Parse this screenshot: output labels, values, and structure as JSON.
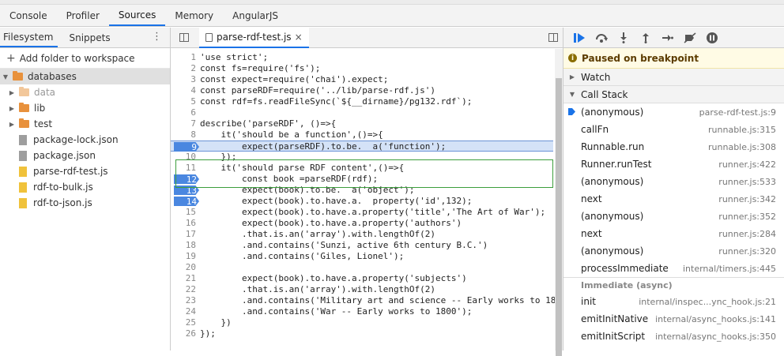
{
  "devtools_tabs": [
    "Console",
    "Profiler",
    "Sources",
    "Memory",
    "AngularJS"
  ],
  "active_tab": "Sources",
  "navigator": {
    "tabs": [
      "Filesystem",
      "Snippets"
    ],
    "add_folder": "Add folder to workspace",
    "tree": [
      {
        "label": "databases",
        "kind": "folder",
        "open": true,
        "depth": 0,
        "selected": true
      },
      {
        "label": "data",
        "kind": "folder",
        "open": false,
        "depth": 1,
        "dim": true
      },
      {
        "label": "lib",
        "kind": "folder",
        "open": false,
        "depth": 1
      },
      {
        "label": "test",
        "kind": "folder",
        "open": false,
        "depth": 1
      },
      {
        "label": "package-lock.json",
        "kind": "file-json",
        "depth": 1
      },
      {
        "label": "package.json",
        "kind": "file-json",
        "depth": 1
      },
      {
        "label": "parse-rdf-test.js",
        "kind": "file-js",
        "depth": 1
      },
      {
        "label": "rdf-to-bulk.js",
        "kind": "file-js",
        "depth": 1
      },
      {
        "label": "rdf-to-json.js",
        "kind": "file-js",
        "depth": 1
      }
    ]
  },
  "editor": {
    "filename": "parse-rdf-test.js",
    "close": "×",
    "lines": [
      {
        "n": "1",
        "text": "'use strict';"
      },
      {
        "n": "2",
        "text": "const fs=require('fs');"
      },
      {
        "n": "3",
        "text": "const expect=require('chai').expect;"
      },
      {
        "n": "4",
        "text": "const parseRDF=require('../lib/parse-rdf.js')"
      },
      {
        "n": "5",
        "text": "const rdf=fs.readFileSync(`${__dirname}/pg132.rdf`);"
      },
      {
        "n": "6",
        "text": ""
      },
      {
        "n": "7",
        "text": "describe('parseRDF', ()=>{"
      },
      {
        "n": "8",
        "text": "    it('should be a function',()=>{"
      },
      {
        "n": "9",
        "text": "        expect(parseRDF).to.be.  a('function');",
        "bp": true,
        "exec": true
      },
      {
        "n": "10",
        "text": "    });"
      },
      {
        "n": "11",
        "text": "    it('should parse RDF content',()=>{"
      },
      {
        "n": "12",
        "text": "        const book =parseRDF(rdf);",
        "bp": true
      },
      {
        "n": "13",
        "text": "        expect(book).to.be.  a('object');",
        "bp": true
      },
      {
        "n": "14",
        "text": "        expect(book).to.have.a.  property('id',132);",
        "bp": true
      },
      {
        "n": "15",
        "text": "        expect(book).to.have.a.property('title','The Art of War');"
      },
      {
        "n": "16",
        "text": "        expect(book).to.have.a.property('authors')"
      },
      {
        "n": "17",
        "text": "        .that.is.an('array').with.lengthOf(2)"
      },
      {
        "n": "18",
        "text": "        .and.contains('Sunzi, active 6th century B.C.')"
      },
      {
        "n": "19",
        "text": "        .and.contains('Giles, Lionel');"
      },
      {
        "n": "20",
        "text": ""
      },
      {
        "n": "21",
        "text": "        expect(book).to.have.a.property('subjects')"
      },
      {
        "n": "22",
        "text": "        .that.is.an('array').with.lengthOf(2)"
      },
      {
        "n": "23",
        "text": "        .and.contains('Military art and science -- Early works to 18"
      },
      {
        "n": "24",
        "text": "        .and.contains('War -- Early works to 1800');"
      },
      {
        "n": "25",
        "text": "    })"
      },
      {
        "n": "26",
        "text": "});"
      }
    ]
  },
  "debugger": {
    "paused": "Paused on breakpoint",
    "watch": "Watch",
    "call_stack": "Call Stack",
    "frames": [
      {
        "fn": "(anonymous)",
        "loc": "parse-rdf-test.js:9",
        "current": true
      },
      {
        "fn": "callFn",
        "loc": "runnable.js:315"
      },
      {
        "fn": "Runnable.run",
        "loc": "runnable.js:308"
      },
      {
        "fn": "Runner.runTest",
        "loc": "runner.js:422"
      },
      {
        "fn": "(anonymous)",
        "loc": "runner.js:533"
      },
      {
        "fn": "next",
        "loc": "runner.js:342"
      },
      {
        "fn": "(anonymous)",
        "loc": "runner.js:352"
      },
      {
        "fn": "next",
        "loc": "runner.js:284"
      },
      {
        "fn": "(anonymous)",
        "loc": "runner.js:320"
      },
      {
        "fn": "processImmediate",
        "loc": "internal/timers.js:445"
      }
    ],
    "async_label": "Immediate (async)",
    "async_frames": [
      {
        "fn": "init",
        "loc": "internal/inspec...ync_hook.js:21"
      },
      {
        "fn": "emitInitNative",
        "loc": "internal/async_hooks.js:141"
      },
      {
        "fn": "emitInitScript",
        "loc": "internal/async_hooks.js:350"
      }
    ]
  }
}
